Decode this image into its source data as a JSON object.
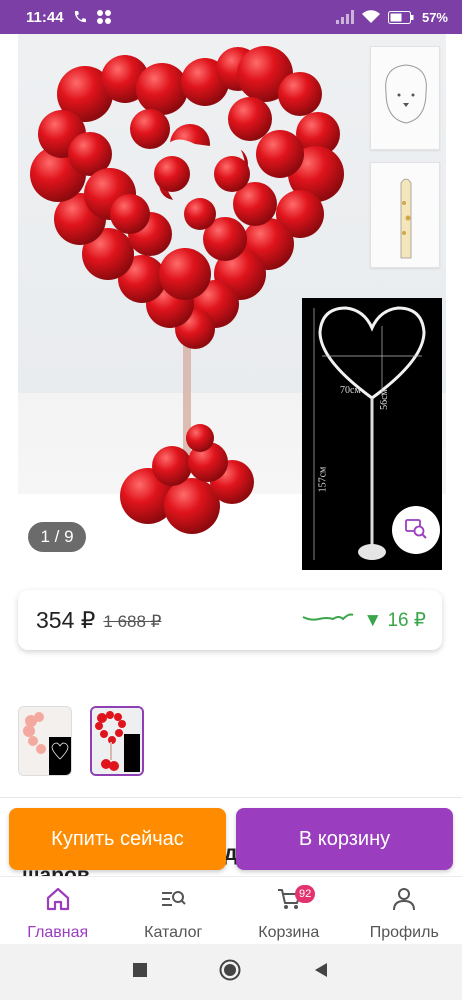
{
  "status_bar": {
    "time": "11:44",
    "battery": "57%"
  },
  "gallery": {
    "counter": "1 / 9",
    "dimensions": {
      "width": "70см",
      "height_heart": "56см",
      "height_total": "157см"
    }
  },
  "price": {
    "current": "354 ₽",
    "old": "1 688 ₽",
    "drop": "▼ 16 ₽",
    "colors": {
      "drop": "#3aa64a",
      "trend_line": "#3aa64a"
    }
  },
  "behind_text": {
    "line1": "д",
    "line2": "шаров"
  },
  "actions": {
    "buy_now": "Купить сейчас",
    "add_to_cart": "В корзину",
    "colors": {
      "buy_now": "#ff8c00",
      "add_to_cart": "#9b3dbf"
    }
  },
  "tabbar": {
    "items": [
      {
        "label": "Главная",
        "icon": "home-icon",
        "active": true
      },
      {
        "label": "Каталог",
        "icon": "catalog-search-icon",
        "active": false
      },
      {
        "label": "Корзина",
        "icon": "cart-icon",
        "active": false,
        "badge": "92"
      },
      {
        "label": "Профиль",
        "icon": "profile-icon",
        "active": false
      }
    ],
    "accent": "#9b3dbf"
  },
  "system_nav": {
    "icons": [
      "recent-apps-icon",
      "home-circle-icon",
      "back-icon"
    ]
  }
}
